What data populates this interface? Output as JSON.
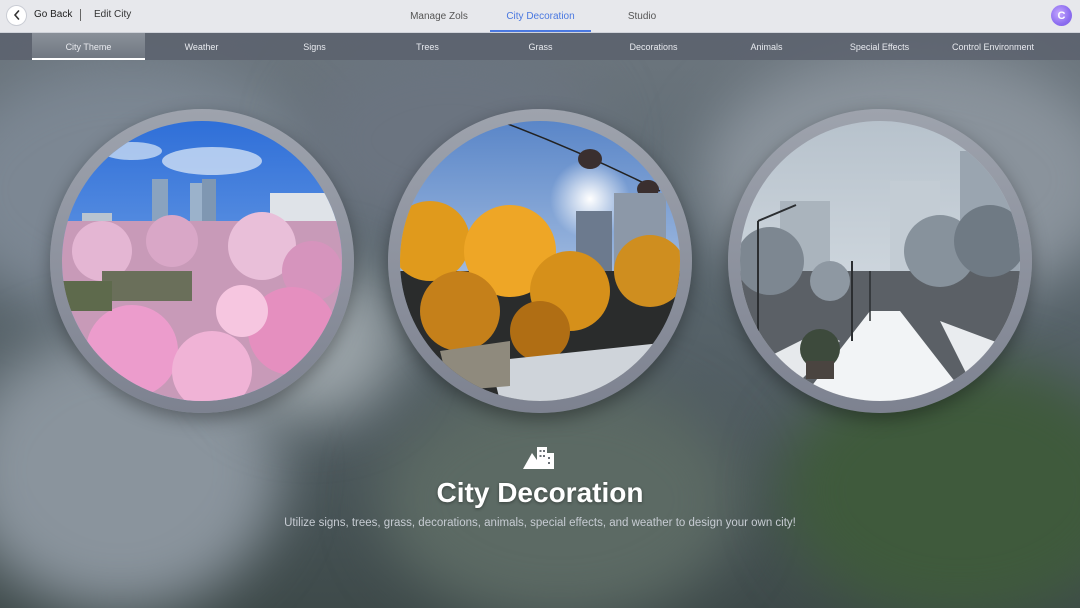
{
  "topbar": {
    "back_label": "Go Back",
    "edit_label": "Edit City",
    "tabs": [
      {
        "label": "Manage Zols",
        "active": false
      },
      {
        "label": "City Decoration",
        "active": true
      },
      {
        "label": "Studio",
        "active": false
      }
    ],
    "avatar_letter": "C",
    "accent_color": "#4a78e0"
  },
  "subnav": {
    "items": [
      {
        "label": "City Theme",
        "active": true
      },
      {
        "label": "Weather",
        "active": false
      },
      {
        "label": "Signs",
        "active": false
      },
      {
        "label": "Trees",
        "active": false
      },
      {
        "label": "Grass",
        "active": false
      },
      {
        "label": "Decorations",
        "active": false
      },
      {
        "label": "Animals",
        "active": false
      },
      {
        "label": "Special Effects",
        "active": false
      },
      {
        "label": "Control Environment",
        "active": false
      }
    ]
  },
  "themes": [
    {
      "name": "spring-cherry-blossom"
    },
    {
      "name": "autumn-ginkgo"
    },
    {
      "name": "winter-snow"
    }
  ],
  "footer": {
    "icon": "city-buildings-icon",
    "title": "City Decoration",
    "subtitle": "Utilize signs, trees, grass, decorations, animals, special effects, and weather to design your own city!"
  }
}
